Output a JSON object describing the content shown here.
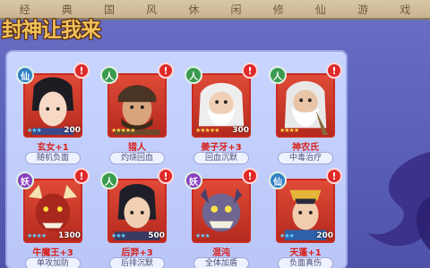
{
  "ribbon": [
    "经",
    "典",
    "国",
    "风",
    "休",
    "闲",
    "修",
    "仙",
    "游",
    "戏"
  ],
  "logo_text": "封神让我来",
  "cards": [
    {
      "faction": "仙",
      "faction_type": "xian",
      "stars": "★★★",
      "star_color": "blue",
      "power": "200",
      "name": "玄女+1",
      "name_color": "red",
      "skill": "随机负面"
    },
    {
      "faction": "人",
      "faction_type": "ren",
      "stars": "★★★★★",
      "star_color": "gold",
      "power": "",
      "name": "猎人",
      "name_color": "red",
      "skill": "灼烧回血"
    },
    {
      "faction": "人",
      "faction_type": "ren",
      "stars": "★★★★★",
      "star_color": "gold",
      "power": "300",
      "name": "姜子牙+3",
      "name_color": "red",
      "skill": "回血沉默"
    },
    {
      "faction": "人",
      "faction_type": "ren",
      "stars": "★★★★",
      "star_color": "gold",
      "power": "",
      "name": "神农氏",
      "name_color": "red",
      "skill": "中毒治疗"
    },
    {
      "faction": "妖",
      "faction_type": "yao",
      "stars": "★★★★",
      "star_color": "blue",
      "power": "1300",
      "name": "牛魔王+3",
      "name_color": "red",
      "skill": "单攻加防"
    },
    {
      "faction": "人",
      "faction_type": "ren",
      "stars": "★★★",
      "star_color": "blue",
      "power": "500",
      "name": "后羿+3",
      "name_color": "red",
      "skill": "后排沉默"
    },
    {
      "faction": "妖",
      "faction_type": "yao",
      "stars": "★★★",
      "star_color": "blue",
      "power": "",
      "name": "混沌",
      "name_color": "red",
      "skill": "全体加盾"
    },
    {
      "faction": "仙",
      "faction_type": "xian",
      "stars": "★★★",
      "star_color": "blue",
      "power": "200",
      "name": "天蓬+1",
      "name_color": "red",
      "skill": "负面真伤"
    }
  ],
  "alert_glyph": "!",
  "colors": {
    "panel": "#c9d5ff",
    "frame": "#c92b20",
    "background": "#5a5fb8"
  }
}
